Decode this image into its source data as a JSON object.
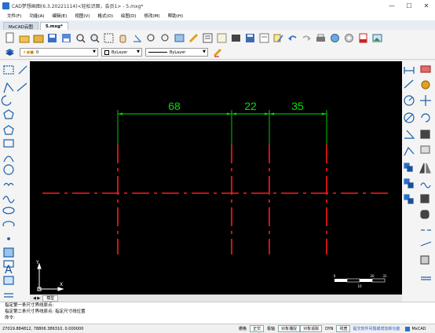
{
  "window": {
    "title": "CAD梦想画图(6.3.20221114)<轻松识图，会员1> - 5.mxg*",
    "minimize": "—",
    "maximize": "☐",
    "close": "✕"
  },
  "menu": [
    "文件(F)",
    "功能(A)",
    "编辑(E)",
    "视图(V)",
    "格式(O)",
    "绘图(D)",
    "修改(M)",
    "帮助(H)"
  ],
  "tabs": [
    {
      "label": "MxCAD云图",
      "active": false
    },
    {
      "label": "5.mxg*",
      "active": true
    }
  ],
  "layer_combo": {
    "value": "0"
  },
  "color_combo": {
    "value": "ByLayer"
  },
  "linetype_combo": {
    "value": "ByLayer"
  },
  "drawing": {
    "dimensions": [
      "68",
      "22",
      "35"
    ],
    "ucs_y": "Y",
    "ucs_x": "X",
    "scale_labels": [
      "0",
      "10",
      "20",
      "31"
    ]
  },
  "layout_tabs": [
    "模型"
  ],
  "command_history": [
    "指定第一条尺寸界线原点:",
    "指定第二条尺寸界线原点:   指定尺寸线位置"
  ],
  "command_prompt": "命令:",
  "status": {
    "coords": "27019.884812,  78806.386310,  0.000000",
    "buttons": [
      {
        "label": "栅格",
        "on": false
      },
      {
        "label": "正交",
        "on": true
      },
      {
        "label": "极轴",
        "on": false
      },
      {
        "label": "对象捕捉",
        "on": true
      },
      {
        "label": "对象追踪",
        "on": true
      },
      {
        "label": "DYN",
        "on": false
      },
      {
        "label": "线宽",
        "on": true
      }
    ],
    "help_link": "提交软件问题或增加新功能",
    "brand": "MxCAD"
  },
  "colors": {
    "canvas_bg": "#000000",
    "dimension": "#00e000",
    "centerline": "#ff1a1a"
  }
}
